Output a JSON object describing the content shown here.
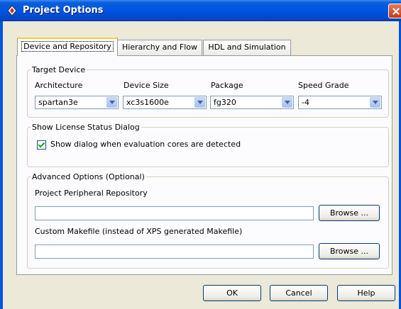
{
  "window": {
    "title": "Project Options"
  },
  "tabs": [
    {
      "label": "Device and Repository"
    },
    {
      "label": "Hierarchy and Flow"
    },
    {
      "label": "HDL and Simulation"
    }
  ],
  "target_device": {
    "legend": "Target Device",
    "fields": [
      {
        "label": "Architecture",
        "value": "spartan3e"
      },
      {
        "label": "Device Size",
        "value": "xc3s1600e"
      },
      {
        "label": "Package",
        "value": "fg320"
      },
      {
        "label": "Speed Grade",
        "value": "-4"
      }
    ]
  },
  "license": {
    "legend": "Show License Status Dialog",
    "checkbox_label": "Show dialog when evaluation cores are detected",
    "checked": true
  },
  "advanced": {
    "legend": "Advanced Options (Optional)",
    "repo_label": "Project Peripheral Repository",
    "repo_value": "",
    "repo_browse": "Browse ...",
    "makefile_label": "Custom Makefile (instead of XPS generated Makefile)",
    "makefile_value": "",
    "makefile_browse": "Browse ..."
  },
  "buttons": {
    "ok": "OK",
    "cancel": "Cancel",
    "help": "Help"
  },
  "colors": {
    "titlebar": "#0054e3",
    "dialog_bg": "#ece9d8",
    "tab_highlight": "#ffc83c"
  }
}
